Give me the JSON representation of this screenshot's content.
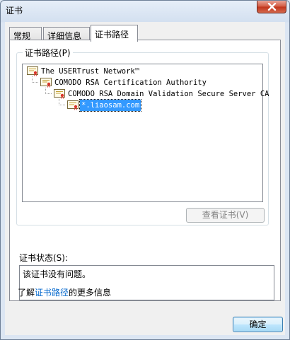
{
  "window": {
    "title": "证书",
    "close_icon": "close-icon"
  },
  "tabs": [
    {
      "label": "常规",
      "active": false
    },
    {
      "label": "详细信息",
      "active": false
    },
    {
      "label": "证书路径",
      "active": true
    }
  ],
  "cert_path": {
    "group_label": "证书路径(P)",
    "nodes": [
      {
        "label": "The USERTrust Network™",
        "level": 0,
        "selected": false
      },
      {
        "label": "COMODO RSA Certification Authority",
        "level": 1,
        "selected": false
      },
      {
        "label": "COMODO RSA Domain Validation Secure Server CA",
        "level": 2,
        "selected": false
      },
      {
        "label": "*.liaosam.com",
        "level": 3,
        "selected": true
      }
    ],
    "view_button": "查看证书(V)"
  },
  "status": {
    "label": "证书状态(S):",
    "text": "该证书没有问题。"
  },
  "learn_more": {
    "prefix": "了解",
    "link": "证书路径",
    "suffix": "的更多信息"
  },
  "ok_button": "确定",
  "colors": {
    "selection": "#3399ff",
    "link": "#0066cc",
    "close_button": "#c1341a"
  }
}
